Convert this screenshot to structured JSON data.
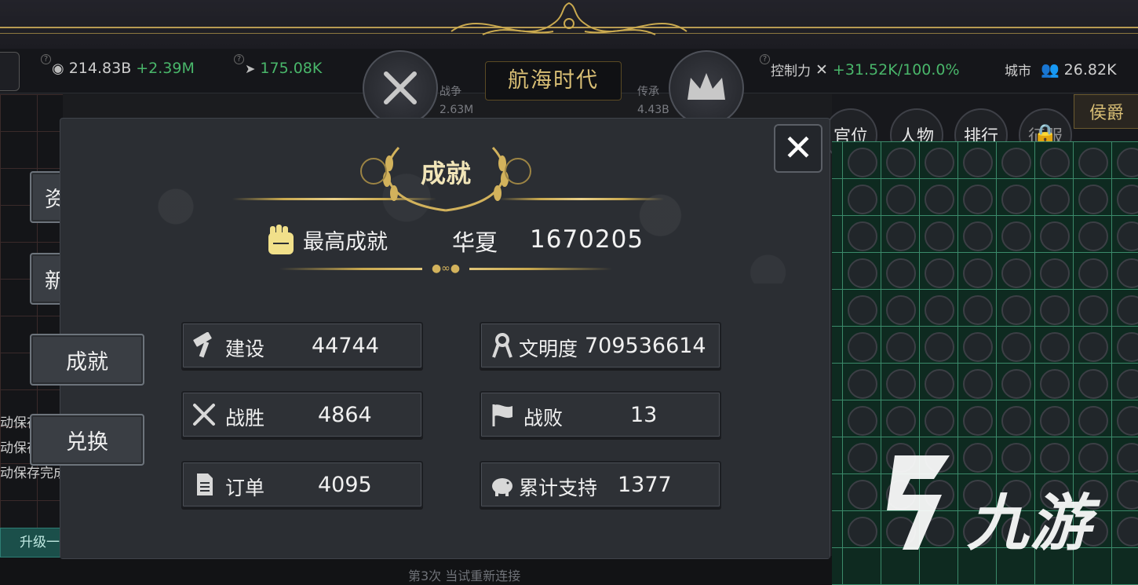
{
  "header": {
    "gold_amount": "214.83B",
    "gold_rate": "+2.39M",
    "food_rate": "175.08K",
    "era_title": "航海时代",
    "war_label": "战争",
    "war_value": "2.63M",
    "legacy_label": "传承",
    "legacy_value": "4.43B",
    "control_label": "控制力",
    "control_rate": "+31.52K",
    "control_percent": "/100.0%",
    "city_label": "城市",
    "city_population": "26.82K"
  },
  "right_tabs": [
    "官位",
    "人物",
    "排行",
    "征服"
  ],
  "rank_badge": "侯爵",
  "side_menu": [
    "资源产量",
    "新的征程",
    "成就",
    "兑换"
  ],
  "background_text": {
    "autosave_lines": [
      "动保存",
      "动保存",
      "动保存完成"
    ],
    "upgrade_label": "升级一",
    "bottom_notice": "第3次 当试重新连接"
  },
  "dialog": {
    "title": "成就",
    "best_label": "最高成就",
    "civ_name": "华夏",
    "best_score": "1670205",
    "stats": [
      {
        "icon": "hammer-icon",
        "label": "建设",
        "value": "44744"
      },
      {
        "icon": "ribbon-icon",
        "label": "文明度",
        "value": "709536614"
      },
      {
        "icon": "crossed-swords-icon",
        "label": "战胜",
        "value": "4864"
      },
      {
        "icon": "flag-icon",
        "label": "战败",
        "value": "13"
      },
      {
        "icon": "document-icon",
        "label": "订单",
        "value": "4095"
      },
      {
        "icon": "piggy-bank-icon",
        "label": "累计支持",
        "value": "1377"
      }
    ],
    "close_symbol": "✕"
  },
  "watermark": "九游",
  "colors": {
    "gold": "#d9bf75",
    "positive": "#49b66a",
    "grid_green": "#3b8a6a"
  }
}
